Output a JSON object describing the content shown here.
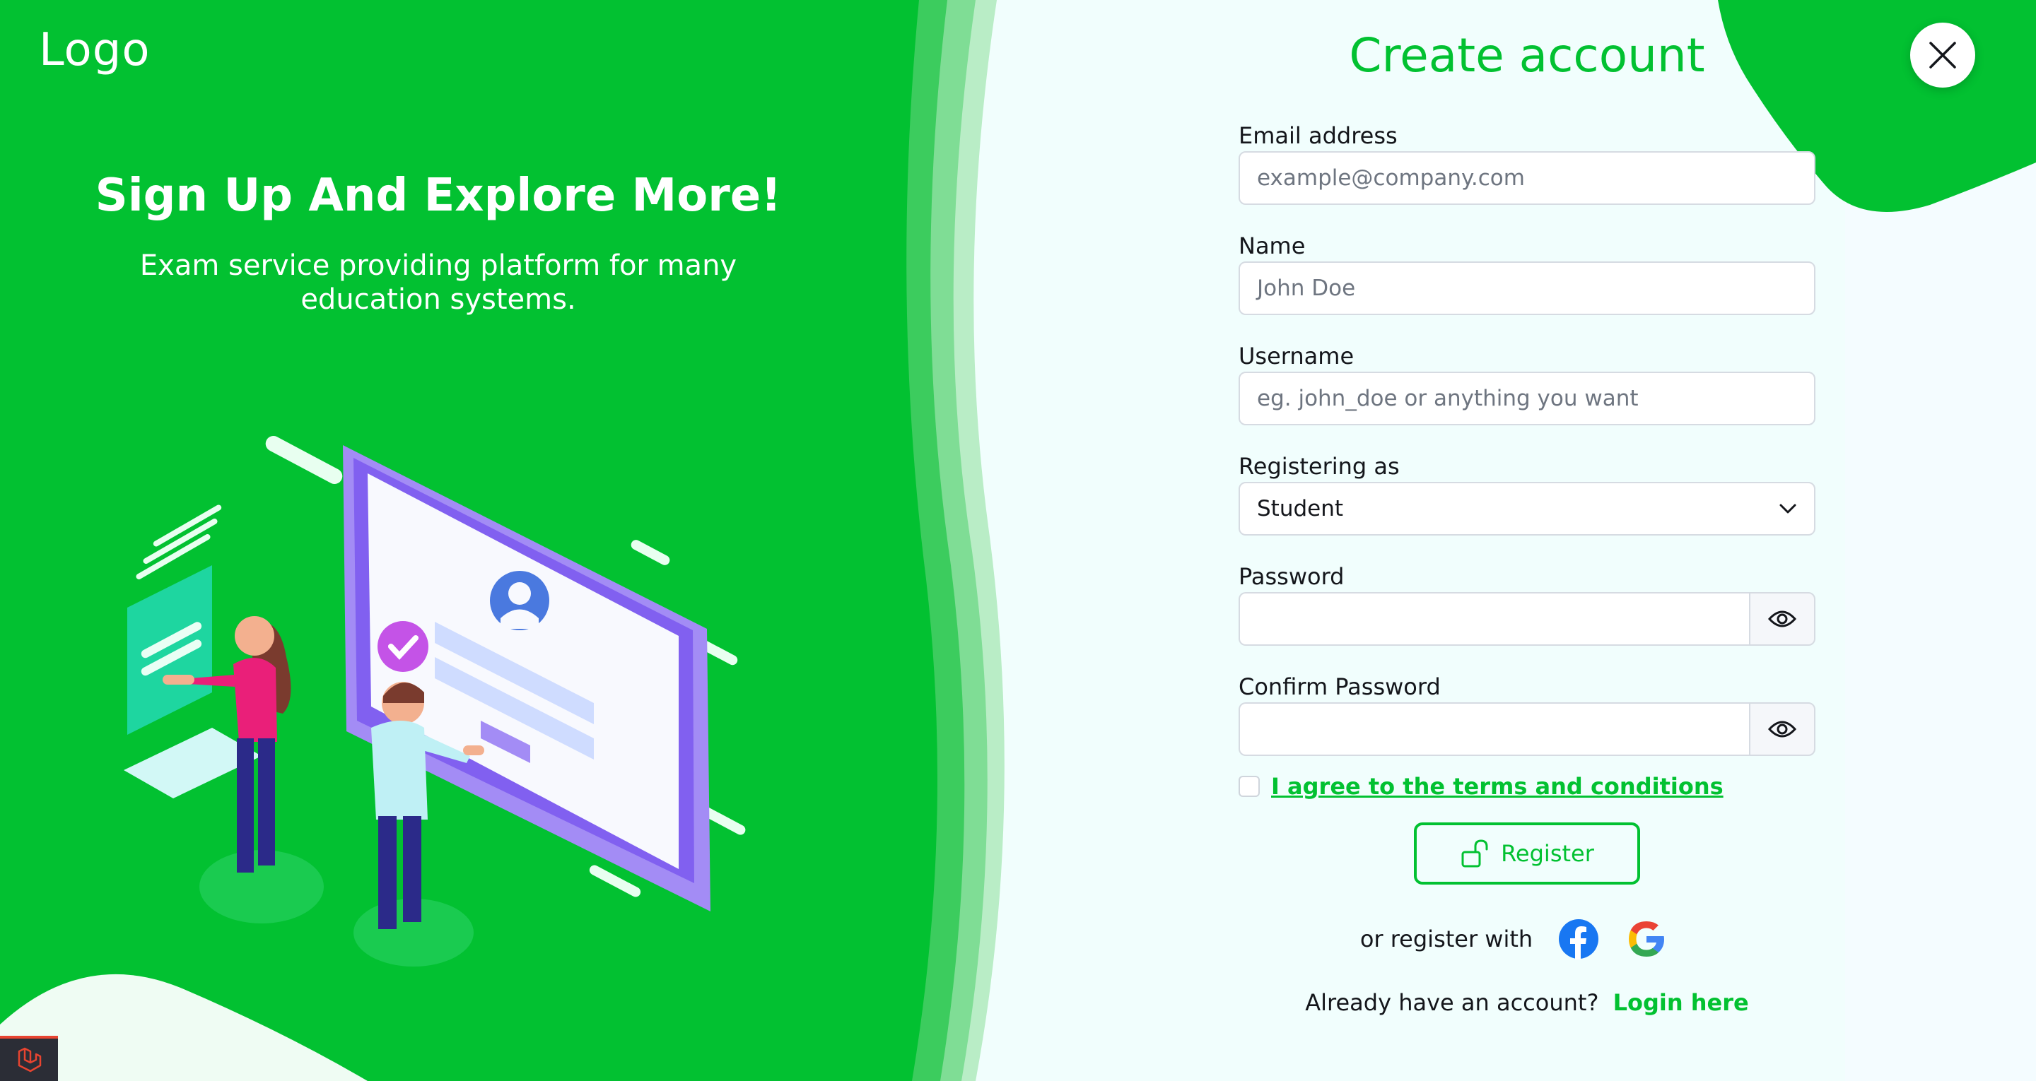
{
  "brand": {
    "logo": "Logo",
    "accent": "#02c131"
  },
  "hero": {
    "title": "Sign Up And Explore More!",
    "subtitle": "Exam service providing platform for many education systems."
  },
  "form": {
    "title": "Create account",
    "email": {
      "label": "Email address",
      "placeholder": "example@company.com",
      "value": ""
    },
    "name": {
      "label": "Name",
      "placeholder": "John Doe",
      "value": ""
    },
    "username": {
      "label": "Username",
      "placeholder": "eg. john_doe or anything you want",
      "value": ""
    },
    "role": {
      "label": "Registering as",
      "selected": "Student"
    },
    "password": {
      "label": "Password",
      "value": ""
    },
    "confirm_password": {
      "label": "Confirm Password",
      "value": ""
    },
    "terms": {
      "checked": false,
      "label": "I agree to the terms and conditions"
    },
    "submit_label": "Register"
  },
  "social": {
    "text": "or register with",
    "providers": [
      "facebook-icon",
      "google-icon"
    ]
  },
  "login": {
    "prompt": "Already have an account?",
    "link": "Login here"
  },
  "icons": {
    "close": "close-icon",
    "eye": "eye-icon",
    "unlock": "unlock-icon",
    "chevron": "chevron-down-icon",
    "corner": "laravel-icon"
  }
}
